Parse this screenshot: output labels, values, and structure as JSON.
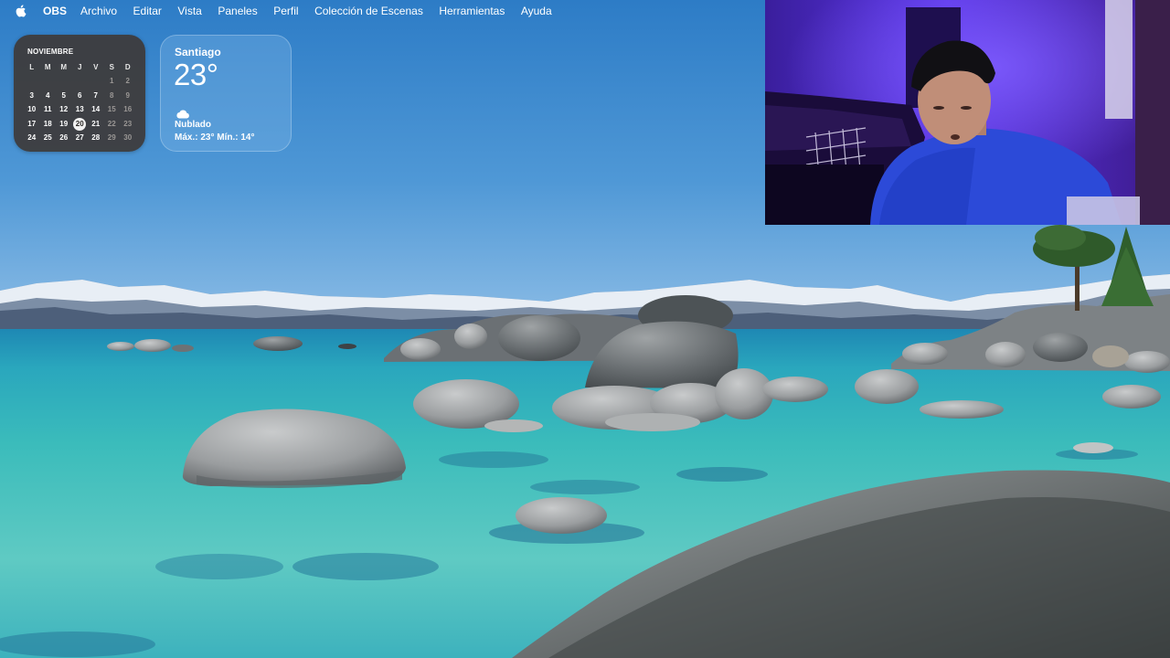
{
  "menubar": {
    "app_name": "OBS",
    "items": [
      "Archivo",
      "Editar",
      "Vista",
      "Paneles",
      "Perfil",
      "Colección de Escenas",
      "Herramientas",
      "Ayuda"
    ]
  },
  "calendar": {
    "month": "NOVIEMBRE",
    "weekdays": [
      "L",
      "M",
      "M",
      "J",
      "V",
      "S",
      "D"
    ],
    "weeks": [
      [
        "",
        "",
        "",
        "",
        "",
        "1",
        "2"
      ],
      [
        "3",
        "4",
        "5",
        "6",
        "7",
        "8",
        "9"
      ],
      [
        "10",
        "11",
        "12",
        "13",
        "14",
        "15",
        "16"
      ],
      [
        "17",
        "18",
        "19",
        "20",
        "21",
        "22",
        "23"
      ],
      [
        "24",
        "25",
        "26",
        "27",
        "28",
        "29",
        "30"
      ]
    ],
    "today": "20"
  },
  "weather": {
    "city": "Santiago",
    "temperature": "23°",
    "condition": "Nublado",
    "range": "Máx.: 23° Mín.: 14°",
    "icon": "cloud-icon"
  },
  "colors": {
    "sky_top": "#2f7fc8",
    "sky_bottom": "#7fb5e2",
    "water_light": "#58c9c2",
    "water_deep": "#1f8cb0",
    "webcam_light": "#6a3dff"
  },
  "icons": [
    "apple-icon",
    "cloud-icon"
  ]
}
